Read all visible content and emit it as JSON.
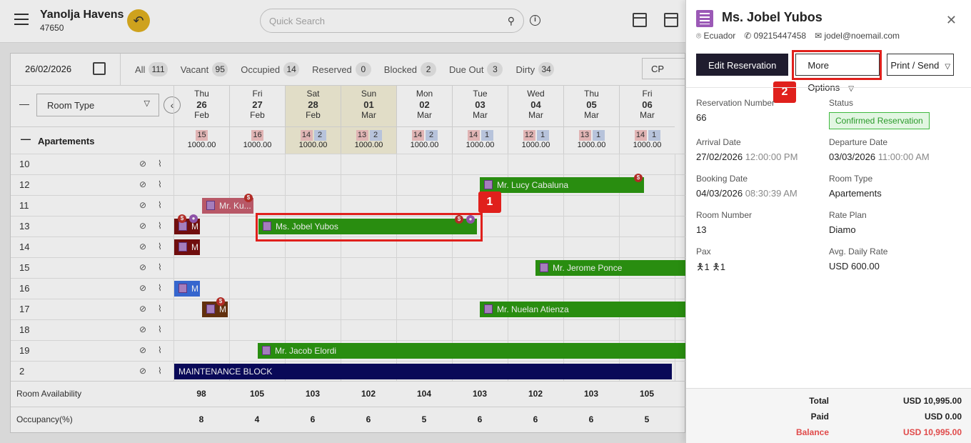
{
  "header": {
    "hotel_name": "Yanolja Havens",
    "hotel_id": "47650",
    "search_placeholder": "Quick Search"
  },
  "filter": {
    "date": "26/02/2026",
    "items": [
      {
        "label": "All",
        "count": "111"
      },
      {
        "label": "Vacant",
        "count": "95"
      },
      {
        "label": "Occupied",
        "count": "14"
      },
      {
        "label": "Reserved",
        "count": "0"
      },
      {
        "label": "Blocked",
        "count": "2"
      },
      {
        "label": "Due Out",
        "count": "3"
      },
      {
        "label": "Dirty",
        "count": "34"
      }
    ],
    "cp_value": "CP"
  },
  "grid": {
    "room_type_label": "Room Type",
    "group": "Apartements",
    "days": [
      {
        "dow": "Thu",
        "d": "26",
        "m": "Feb",
        "r": "15",
        "b": "",
        "price": "1000.00",
        "we": false
      },
      {
        "dow": "Fri",
        "d": "27",
        "m": "Feb",
        "r": "16",
        "b": "",
        "price": "1000.00",
        "we": false
      },
      {
        "dow": "Sat",
        "d": "28",
        "m": "Feb",
        "r": "14",
        "b": "2",
        "price": "1000.00",
        "we": true
      },
      {
        "dow": "Sun",
        "d": "01",
        "m": "Mar",
        "r": "13",
        "b": "2",
        "price": "1000.00",
        "we": true
      },
      {
        "dow": "Mon",
        "d": "02",
        "m": "Mar",
        "r": "14",
        "b": "2",
        "price": "1000.00",
        "we": false
      },
      {
        "dow": "Tue",
        "d": "03",
        "m": "Mar",
        "r": "14",
        "b": "1",
        "price": "1000.00",
        "we": false
      },
      {
        "dow": "Wed",
        "d": "04",
        "m": "Mar",
        "r": "12",
        "b": "1",
        "price": "1000.00",
        "we": false
      },
      {
        "dow": "Thu",
        "d": "05",
        "m": "Mar",
        "r": "13",
        "b": "1",
        "price": "1000.00",
        "we": false
      },
      {
        "dow": "Fri",
        "d": "06",
        "m": "Mar",
        "r": "14",
        "b": "1",
        "price": "1000.00",
        "we": false
      }
    ],
    "rooms": [
      "10",
      "12",
      "11",
      "13",
      "14",
      "15",
      "16",
      "17",
      "18",
      "19",
      "2"
    ],
    "reservations": {
      "lucy": "Mr. Lucy Cabaluna",
      "ku": "Mr. Ku...",
      "jobel": "Ms. Jobel Yubos",
      "m": "M",
      "jerome": "Mr. Jerome Ponce",
      "nuelan": "Mr. Nuelan Atienza",
      "jacob": "Mr. Jacob Elordi",
      "block": "MAINTENANCE BLOCK"
    },
    "availability_label": "Room Availability",
    "availability": [
      "98",
      "105",
      "103",
      "102",
      "104",
      "103",
      "102",
      "103",
      "105"
    ],
    "occupancy_label": "Occupancy(%)",
    "occupancy": [
      "8",
      "4",
      "6",
      "6",
      "5",
      "6",
      "6",
      "6",
      "5"
    ]
  },
  "callouts": {
    "one": "1",
    "two": "2"
  },
  "drawer": {
    "guest_name": "Ms. Jobel Yubos",
    "country": "Ecuador",
    "phone": "09215447458",
    "email": "jodel@noemail.com",
    "edit_label": "Edit Reservation",
    "more_label": "More Options",
    "print_label": "Print / Send",
    "reservation_number_label": "Reservation Number",
    "reservation_number": "66",
    "status_label": "Status",
    "status": "Confirmed Reservation",
    "arrival_label": "Arrival Date",
    "arrival_date": "27/02/2026",
    "arrival_time": "12:00:00 PM",
    "departure_label": "Departure Date",
    "departure_date": "03/03/2026",
    "departure_time": "11:00:00 AM",
    "booking_label": "Booking Date",
    "booking_date": "04/03/2026",
    "booking_time": "08:30:39 AM",
    "room_type_label": "Room Type",
    "room_type": "Apartements",
    "room_number_label": "Room Number",
    "room_number": "13",
    "rate_plan_label": "Rate Plan",
    "rate_plan": "Diamo",
    "pax_label": "Pax",
    "pax_adults": "1",
    "pax_children": "1",
    "adr_label": "Avg. Daily Rate",
    "adr": "USD 600.00",
    "total_label": "Total",
    "total": "USD 10,995.00",
    "paid_label": "Paid",
    "paid": "USD 0.00",
    "balance_label": "Balance",
    "balance": "USD 10,995.00"
  }
}
